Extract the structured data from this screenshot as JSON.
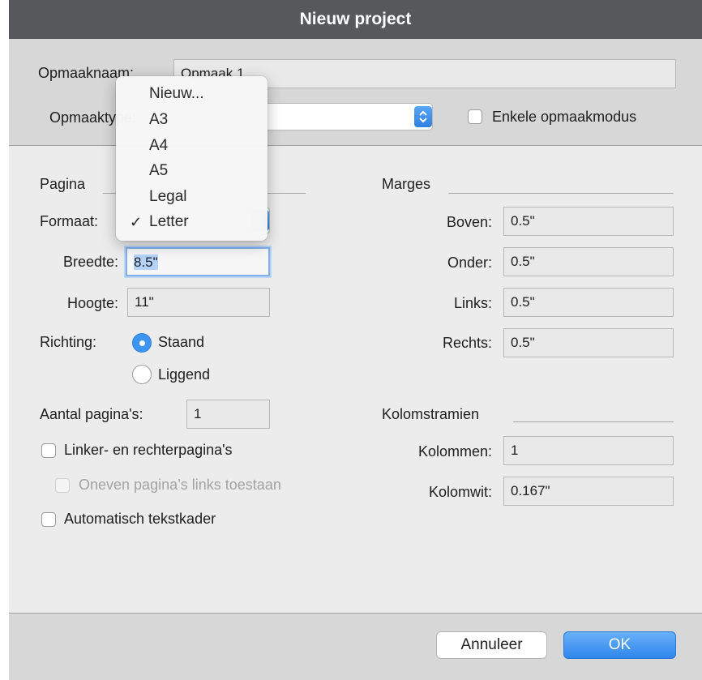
{
  "window": {
    "title": "Nieuw project"
  },
  "top": {
    "layout_name_label": "Opmaaknaam:",
    "layout_name_value": "Opmaak 1",
    "layout_type_label": "Opmaaktype:",
    "single_layout_mode_label": "Enkele opmaakmodus",
    "single_layout_mode_checked": false
  },
  "page": {
    "group_label": "Pagina",
    "format_label": "Formaat:",
    "format_value": "Letter",
    "width_label": "Breedte:",
    "width_value": "8.5\"",
    "height_label": "Hoogte:",
    "height_value": "11\"",
    "orientation_label": "Richting:",
    "orientation_options": [
      "Staand",
      "Liggend"
    ],
    "orientation_selected": "Staand",
    "page_count_label": "Aantal pagina's:",
    "page_count_value": "1",
    "facing_pages_label": "Linker- en rechterpagina's",
    "facing_pages_checked": false,
    "allow_odd_left_label": "Oneven pagina’s links toestaan",
    "allow_odd_left_enabled": false,
    "auto_textbox_label": "Automatisch tekstkader",
    "auto_textbox_checked": false
  },
  "format_menu": {
    "items": [
      "Nieuw...",
      "A3",
      "A4",
      "A5",
      "Legal",
      "Letter"
    ],
    "checked": "Letter",
    "check_glyph": "✓"
  },
  "margins": {
    "group_label": "Marges",
    "top_label": "Boven:",
    "top_value": "0.5\"",
    "bottom_label": "Onder:",
    "bottom_value": "0.5\"",
    "left_label": "Links:",
    "left_value": "0.5\"",
    "right_label": "Rechts:",
    "right_value": "0.5\""
  },
  "columns": {
    "group_label": "Kolomstramien",
    "columns_label": "Kolommen:",
    "columns_value": "1",
    "gutter_label": "Kolomwit:",
    "gutter_value": "0.167\""
  },
  "footer": {
    "cancel_label": "Annuleer",
    "ok_label": "OK"
  },
  "colors": {
    "accent": "#3d95f0",
    "titlebar": "#56585c",
    "panel": "#ececec",
    "section": "#d7d7d7"
  }
}
